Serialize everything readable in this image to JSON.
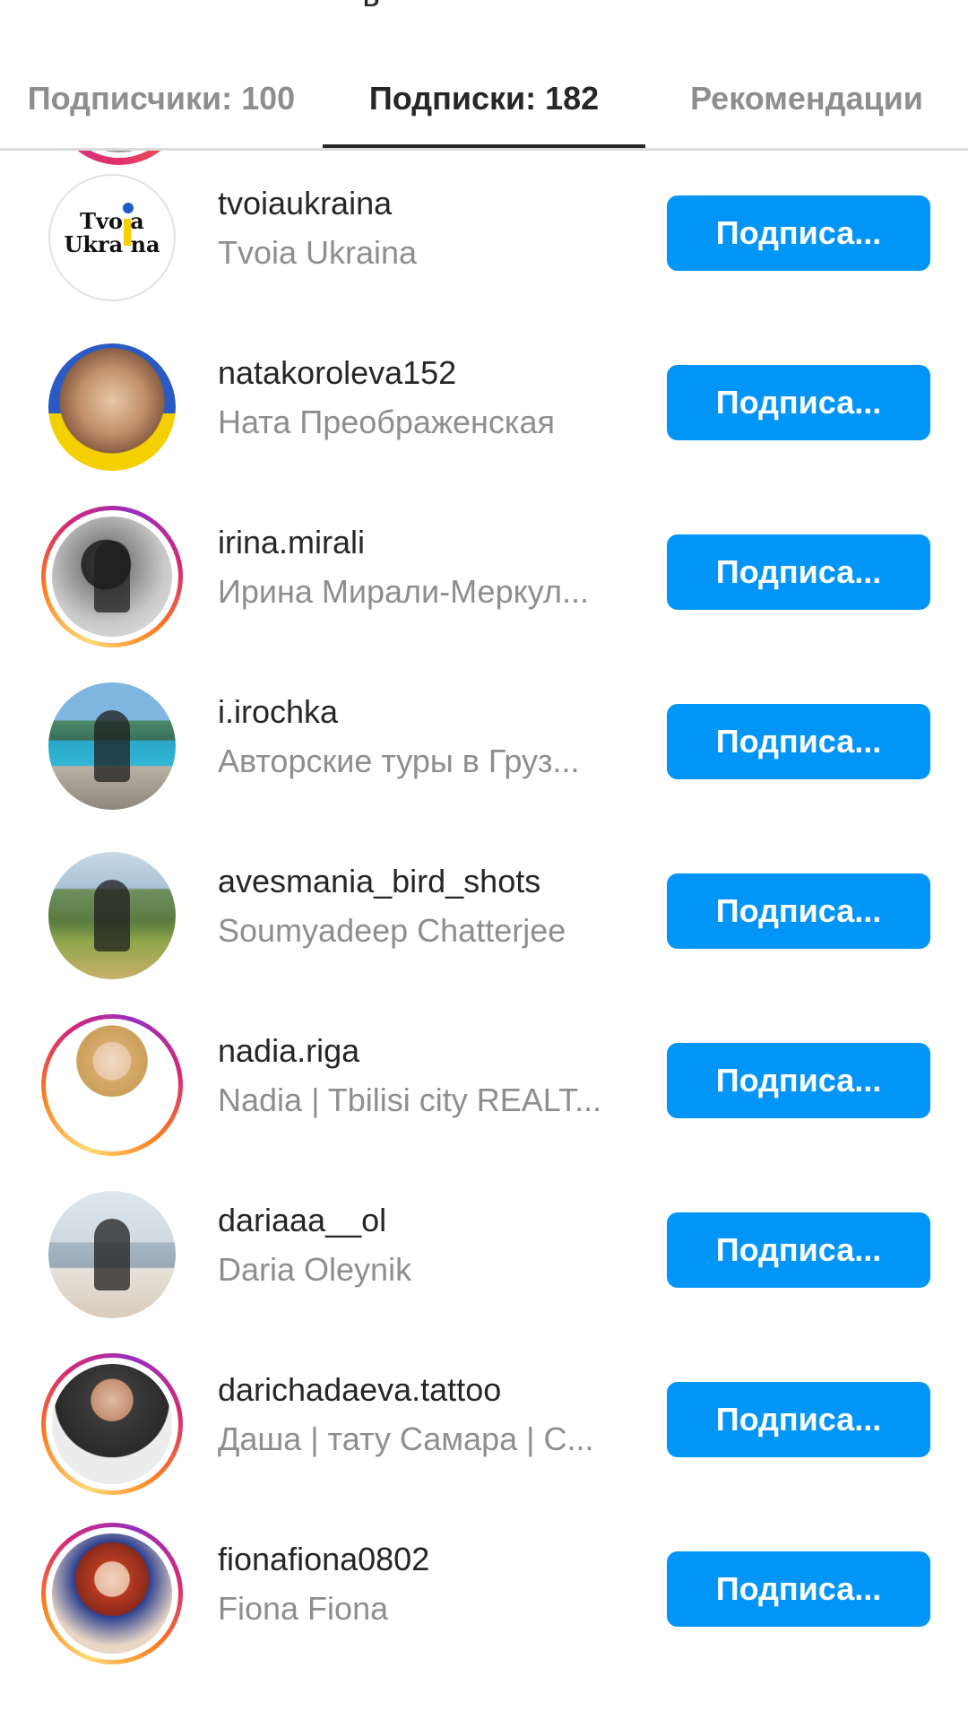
{
  "tabs": [
    {
      "label": "Подписчики: 100",
      "active": false
    },
    {
      "label": "Подписки: 182",
      "active": true
    },
    {
      "label": "Рекомендации",
      "active": false
    }
  ],
  "colors": {
    "accent": "#0095f6",
    "text": "#262626",
    "muted": "#8e8e8e"
  },
  "logo": {
    "line1": "Tvo a",
    "line2": "Ukra na"
  },
  "users": [
    {
      "username": "tvoiaukraina",
      "full_name": "Tvoia Ukraina",
      "button": "Подписа..."
    },
    {
      "username": "natakoroleva152",
      "full_name": "Ната Преображенская",
      "button": "Подписа..."
    },
    {
      "username": "irina.mirali",
      "full_name": "Ирина Мирали-Меркул...",
      "button": "Подписа..."
    },
    {
      "username": "i.irochka",
      "full_name": "Авторские туры в Груз...",
      "button": "Подписа..."
    },
    {
      "username": "avesmania_bird_shots",
      "full_name": "Soumyadeep Chatterjee",
      "button": "Подписа..."
    },
    {
      "username": "nadia.riga",
      "full_name": "Nadia | Tbilisi city REALT...",
      "button": "Подписа..."
    },
    {
      "username": "dariaaa__ol",
      "full_name": "Daria Oleynik",
      "button": "Подписа..."
    },
    {
      "username": "darichadaeva.tattoo",
      "full_name": "Даша | тату Самара | С...",
      "button": "Подписа..."
    },
    {
      "username": "fionafiona0802",
      "full_name": "Fiona Fiona",
      "button": "Подписа..."
    }
  ]
}
